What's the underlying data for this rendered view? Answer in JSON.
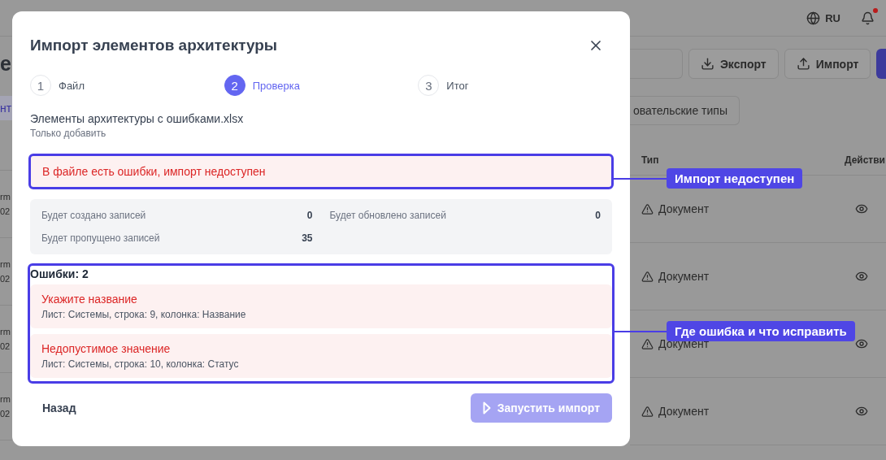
{
  "topbar": {
    "language": "RU",
    "has_notifications": true
  },
  "page": {
    "title_fragment": "е",
    "tab_fragment": "нт",
    "toolbar": [
      {
        "label": "Экспорт"
      },
      {
        "label": "Импорт"
      }
    ],
    "filter_chip": "овательские типы"
  },
  "table": {
    "columns": [
      "Тип",
      "Действи"
    ],
    "rows": [
      {
        "column_1": [
          "rm",
          "02"
        ],
        "type": "Документ"
      },
      {
        "column_1": [
          "rm",
          "02"
        ],
        "type": "Документ"
      },
      {
        "column_1": [
          "rm",
          "02"
        ],
        "type": "Документ"
      },
      {
        "column_1": [
          "rm",
          "02"
        ],
        "type": "Документ"
      }
    ]
  },
  "modal": {
    "title": "Импорт элементов архитектуры",
    "steps": [
      {
        "number": "1",
        "label": "Файл",
        "selected": false
      },
      {
        "number": "2",
        "label": "Проверка",
        "selected": true
      },
      {
        "number": "3",
        "label": "Итог",
        "selected": false
      }
    ],
    "file_name": "Элементы архитектуры с ошибками.xlsx",
    "mode": "Только добавить",
    "alert": "В файле есть ошибки, импорт недоступен",
    "stats": [
      {
        "label": "Будет создано записей",
        "value": "0"
      },
      {
        "label": "Будет обновлено записей",
        "value": "0"
      },
      {
        "label": "Будет пропущено записей",
        "value": "35"
      }
    ],
    "errors": {
      "title": "Ошибки: 2",
      "items": [
        {
          "message": "Укажите название",
          "location": "Лист: Системы, строка: 9, колонка: Название"
        },
        {
          "message": "Недопустимое значение",
          "location": "Лист: Системы, строка: 10, колонка: Статус"
        }
      ]
    },
    "back_button": "Назад",
    "start_button": {
      "label": "Запустить импорт",
      "disabled": true
    }
  },
  "annotations": [
    {
      "label": "Импорт недоступен"
    },
    {
      "label": "Где ошибка и что исправить"
    }
  ]
}
